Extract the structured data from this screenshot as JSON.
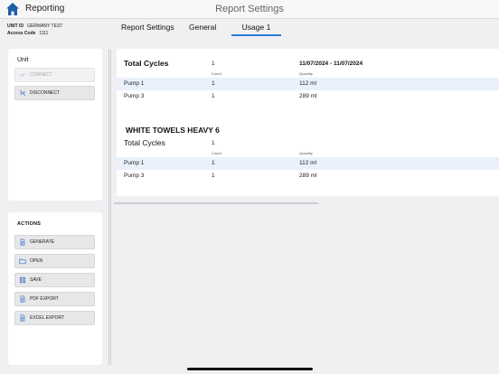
{
  "header": {
    "app_name": "Reporting",
    "title": "Report Settings",
    "home_icon": "home-icon"
  },
  "unit_info": {
    "unit_id_label": "UNIT ID",
    "unit_id_value": "GERMANY TEST",
    "access_code_label": "Access Code",
    "access_code_value": "1111"
  },
  "tabs": [
    {
      "label": "Report Settings",
      "active": false
    },
    {
      "label": "General",
      "active": false
    },
    {
      "label": "Usage 1",
      "active": true
    }
  ],
  "unit_panel": {
    "title": "Unit",
    "connect_label": "CONNECT",
    "disconnect_label": "DISCONNECT"
  },
  "actions_panel": {
    "title": "ACTIONS",
    "buttons": [
      {
        "label": "GENERATE",
        "icon": "document-icon"
      },
      {
        "label": "OPEN",
        "icon": "folder-icon"
      },
      {
        "label": "SAVE",
        "icon": "save-icon"
      },
      {
        "label": "PDF EXPORT",
        "icon": "document-icon"
      },
      {
        "label": "EXCEL EXPORT",
        "icon": "document-icon"
      }
    ]
  },
  "usage": {
    "total_cycles_label": "Total Cycles",
    "total_cycles_value": "1",
    "date_range": "11/07/2024 - 11/07/2024",
    "count_label": "Count",
    "quantity_label": "Quantity",
    "rows": [
      {
        "name": "Pump 1",
        "count": "1",
        "quantity": "112 ml"
      },
      {
        "name": "Pump 3",
        "count": "1",
        "quantity": "289 ml"
      }
    ],
    "program": {
      "title": "WHITE TOWELS HEAVY 6",
      "total_cycles_label": "Total Cycles",
      "total_cycles_value": "1",
      "count_label": "Count",
      "quantity_label": "Quantity",
      "rows": [
        {
          "name": "Pump 1",
          "count": "1",
          "quantity": "112 ml"
        },
        {
          "name": "Pump 3",
          "count": "1",
          "quantity": "289 ml"
        }
      ]
    }
  },
  "colors": {
    "accent": "#2a7bd6",
    "home_icon": "#1f5fa8",
    "row_highlight": "#eaf1fb"
  }
}
